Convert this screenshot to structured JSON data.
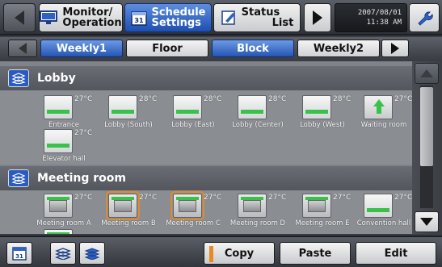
{
  "topbar": {
    "tabs": [
      {
        "label_1": "Monitor/",
        "label_2": "Operation",
        "icon": "monitor-icon"
      },
      {
        "label_1": "Schedule",
        "label_2": "Settings",
        "icon": "calendar-31-icon"
      },
      {
        "label_1": "Status",
        "label_2": "List",
        "icon": "status-pen-icon"
      }
    ],
    "date": "2007/08/01",
    "time": "11:38 AM",
    "tool_icon": "wrench-icon"
  },
  "subtabs": {
    "items": [
      {
        "label": "Weekly1",
        "active": true
      },
      {
        "label": "Floor",
        "active": false
      },
      {
        "label": "Block",
        "active": true
      },
      {
        "label": "Weekly2",
        "active": false
      }
    ]
  },
  "groups": [
    {
      "title": "Lobby",
      "units": [
        {
          "name": "Entrance",
          "temp": "27°C",
          "type": "wall",
          "selected": false
        },
        {
          "name": "Lobby (South)",
          "temp": "28°C",
          "type": "wall",
          "selected": false
        },
        {
          "name": "Lobby (East)",
          "temp": "28°C",
          "type": "wall",
          "selected": false
        },
        {
          "name": "Lobby (Center)",
          "temp": "28°C",
          "type": "wall",
          "selected": false
        },
        {
          "name": "Lobby (West)",
          "temp": "28°C",
          "type": "wall",
          "selected": false
        },
        {
          "name": "Waiting room",
          "temp": "27°C",
          "type": "vent",
          "selected": false
        },
        {
          "name": "Elevator hall",
          "temp": "27°C",
          "type": "wall",
          "selected": false
        }
      ]
    },
    {
      "title": "Meeting room",
      "units": [
        {
          "name": "Meeting room A",
          "temp": "27°C",
          "type": "cassette",
          "selected": false
        },
        {
          "name": "Meeting room B",
          "temp": "27°C",
          "type": "cassette",
          "selected": true
        },
        {
          "name": "Meeting room C",
          "temp": "27°C",
          "type": "cassette",
          "selected": true
        },
        {
          "name": "Meeting room D",
          "temp": "27°C",
          "type": "cassette",
          "selected": false
        },
        {
          "name": "Meeting room E",
          "temp": "27°C",
          "type": "cassette",
          "selected": false
        },
        {
          "name": "Convention hall",
          "temp": "27°C",
          "type": "wall",
          "selected": false
        }
      ]
    }
  ],
  "bottombar": {
    "icons": [
      "calendar-31-icon",
      "group-blocks-icon",
      "stack-blocks-icon"
    ],
    "copy_label": "Copy",
    "paste_label": "Paste",
    "edit_label": "Edit"
  },
  "colors": {
    "accent": "#2455b2",
    "status_on": "#39c24a",
    "selected_outline": "#e08a2a",
    "copy_marker": "#e88a1f"
  }
}
